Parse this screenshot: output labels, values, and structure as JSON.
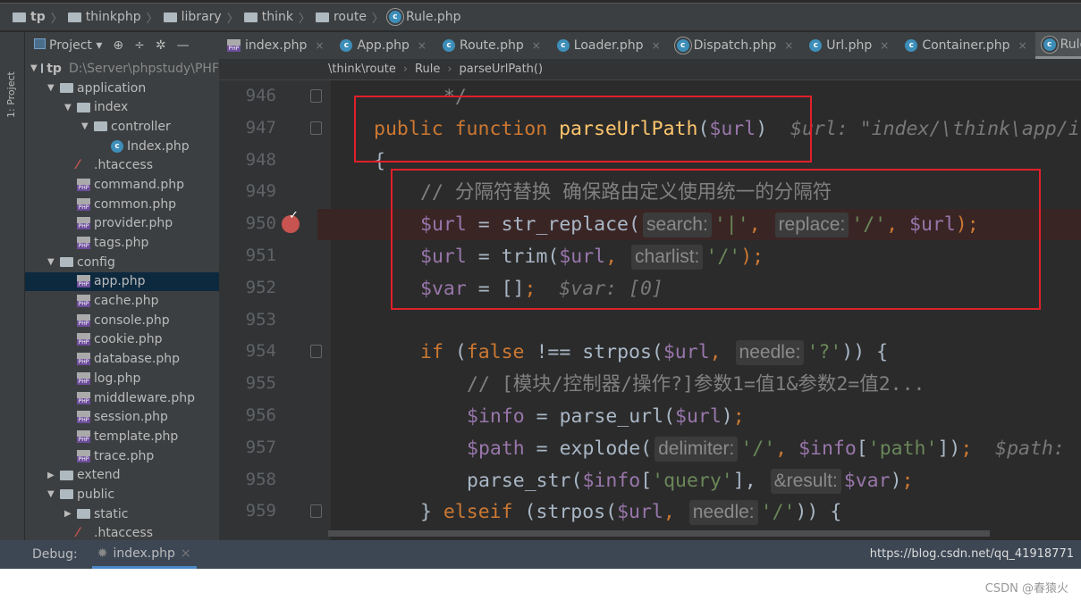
{
  "breadcrumb": [
    {
      "label": "tp",
      "icon": "folder"
    },
    {
      "label": "thinkphp",
      "icon": "folder"
    },
    {
      "label": "library",
      "icon": "folder"
    },
    {
      "label": "think",
      "icon": "folder"
    },
    {
      "label": "route",
      "icon": "folder"
    },
    {
      "label": "Rule.php",
      "icon": "php-class"
    }
  ],
  "left_stripe": {
    "label": "1: Project"
  },
  "project_panel": {
    "title": "Project",
    "tree": [
      {
        "label": "tp",
        "extra": "D:\\Server\\phpstudy\\PHF",
        "depth": 0,
        "type": "folder",
        "expanded": true
      },
      {
        "label": "application",
        "depth": 1,
        "type": "folder",
        "expanded": true
      },
      {
        "label": "index",
        "depth": 2,
        "type": "folder",
        "expanded": true
      },
      {
        "label": "controller",
        "depth": 3,
        "type": "folder",
        "expanded": true
      },
      {
        "label": "Index.php",
        "depth": 4,
        "type": "class"
      },
      {
        "label": ".htaccess",
        "depth": 2,
        "type": "htaccess"
      },
      {
        "label": "command.php",
        "depth": 2,
        "type": "php"
      },
      {
        "label": "common.php",
        "depth": 2,
        "type": "php"
      },
      {
        "label": "provider.php",
        "depth": 2,
        "type": "php"
      },
      {
        "label": "tags.php",
        "depth": 2,
        "type": "php"
      },
      {
        "label": "config",
        "depth": 1,
        "type": "folder",
        "expanded": true
      },
      {
        "label": "app.php",
        "depth": 2,
        "type": "php",
        "selected": true
      },
      {
        "label": "cache.php",
        "depth": 2,
        "type": "php"
      },
      {
        "label": "console.php",
        "depth": 2,
        "type": "php"
      },
      {
        "label": "cookie.php",
        "depth": 2,
        "type": "php"
      },
      {
        "label": "database.php",
        "depth": 2,
        "type": "php"
      },
      {
        "label": "log.php",
        "depth": 2,
        "type": "php"
      },
      {
        "label": "middleware.php",
        "depth": 2,
        "type": "php"
      },
      {
        "label": "session.php",
        "depth": 2,
        "type": "php"
      },
      {
        "label": "template.php",
        "depth": 2,
        "type": "php"
      },
      {
        "label": "trace.php",
        "depth": 2,
        "type": "php"
      },
      {
        "label": "extend",
        "depth": 1,
        "type": "folder",
        "expanded": false
      },
      {
        "label": "public",
        "depth": 1,
        "type": "folder",
        "expanded": true
      },
      {
        "label": "static",
        "depth": 2,
        "type": "folder",
        "expanded": false
      },
      {
        "label": ".htaccess",
        "depth": 2,
        "type": "htaccess"
      }
    ]
  },
  "tabs": [
    {
      "label": "index.php",
      "icon": "php"
    },
    {
      "label": "App.php",
      "icon": "class"
    },
    {
      "label": "Route.php",
      "icon": "class"
    },
    {
      "label": "Loader.php",
      "icon": "class"
    },
    {
      "label": "Dispatch.php",
      "icon": "abstract-class"
    },
    {
      "label": "Url.php",
      "icon": "class"
    },
    {
      "label": "Container.php",
      "icon": "class"
    },
    {
      "label": "Rule.php",
      "icon": "abstract-class",
      "active": true
    }
  ],
  "navbar": [
    "\\think\\route",
    "Rule",
    "parseUrlPath()"
  ],
  "editor": {
    "breakpoint_line": "950",
    "lines": [
      {
        "n": "946",
        "indent": 1,
        "tokens": [
          {
            "t": "  */",
            "c": "cm"
          }
        ],
        "fold": true
      },
      {
        "n": "947",
        "indent": 0,
        "tokens": [
          {
            "t": "public function ",
            "c": "kw"
          },
          {
            "t": "parseUrlPath",
            "c": "fn"
          },
          {
            "t": "(",
            "c": ""
          },
          {
            "t": "$url",
            "c": "var"
          },
          {
            "t": ")  ",
            "c": ""
          },
          {
            "t": "$url: \"index/\\think\\app/i",
            "c": "dbg"
          }
        ],
        "fold": true
      },
      {
        "n": "948",
        "indent": 0,
        "tokens": [
          {
            "t": "{",
            "c": ""
          }
        ]
      },
      {
        "n": "949",
        "indent": 1,
        "tokens": [
          {
            "t": "// 分隔符替换 确保路由定义使用统一的分隔符",
            "c": "cm"
          }
        ]
      },
      {
        "n": "950",
        "indent": 1,
        "tokens": [
          {
            "t": "$url",
            "c": "var"
          },
          {
            "t": " = str_replace(",
            "c": ""
          },
          {
            "t": "search:",
            "c": "hint"
          },
          {
            "t": "'|'",
            "c": "str"
          },
          {
            "t": ", ",
            "c": "kw"
          },
          {
            "t": "replace:",
            "c": "hint"
          },
          {
            "t": "'/'",
            "c": "str"
          },
          {
            "t": ", ",
            "c": "kw"
          },
          {
            "t": "$url",
            "c": "var"
          },
          {
            "t": ");",
            "c": "kw"
          }
        ]
      },
      {
        "n": "951",
        "indent": 1,
        "tokens": [
          {
            "t": "$url",
            "c": "var"
          },
          {
            "t": " = trim(",
            "c": ""
          },
          {
            "t": "$url",
            "c": "var"
          },
          {
            "t": ", ",
            "c": "kw"
          },
          {
            "t": "charlist:",
            "c": "hint"
          },
          {
            "t": "'/'",
            "c": "str"
          },
          {
            "t": ");",
            "c": "kw"
          }
        ]
      },
      {
        "n": "952",
        "indent": 1,
        "tokens": [
          {
            "t": "$var",
            "c": "var"
          },
          {
            "t": " = []",
            "c": ""
          },
          {
            "t": ";",
            "c": "kw"
          },
          {
            "t": "  $var: [0]",
            "c": "dbg"
          }
        ]
      },
      {
        "n": "953",
        "indent": 1,
        "tokens": []
      },
      {
        "n": "954",
        "indent": 1,
        "tokens": [
          {
            "t": "if",
            "c": "kw"
          },
          {
            "t": " (",
            "c": ""
          },
          {
            "t": "false",
            "c": "kw"
          },
          {
            "t": " !== strpos(",
            "c": ""
          },
          {
            "t": "$url",
            "c": "var"
          },
          {
            "t": ", ",
            "c": "kw"
          },
          {
            "t": "needle:",
            "c": "hint"
          },
          {
            "t": "'?'",
            "c": "str"
          },
          {
            "t": ")) {",
            "c": ""
          }
        ],
        "fold": true
      },
      {
        "n": "955",
        "indent": 2,
        "tokens": [
          {
            "t": "// [模块/控制器/操作?]参数1=值1&参数2=值2...",
            "c": "cm"
          }
        ]
      },
      {
        "n": "956",
        "indent": 2,
        "tokens": [
          {
            "t": "$info",
            "c": "var"
          },
          {
            "t": " = parse_url(",
            "c": ""
          },
          {
            "t": "$url",
            "c": "var"
          },
          {
            "t": ")",
            "c": ""
          },
          {
            "t": ";",
            "c": "kw"
          }
        ]
      },
      {
        "n": "957",
        "indent": 2,
        "tokens": [
          {
            "t": "$path",
            "c": "var"
          },
          {
            "t": " = explode(",
            "c": ""
          },
          {
            "t": "delimiter:",
            "c": "hint"
          },
          {
            "t": "'/'",
            "c": "str"
          },
          {
            "t": ", ",
            "c": "kw"
          },
          {
            "t": "$info",
            "c": "var"
          },
          {
            "t": "[",
            "c": ""
          },
          {
            "t": "'path'",
            "c": "str"
          },
          {
            "t": "])",
            "c": ""
          },
          {
            "t": ";",
            "c": "kw"
          },
          {
            "t": "  $path:",
            "c": "dbg"
          }
        ]
      },
      {
        "n": "958",
        "indent": 2,
        "tokens": [
          {
            "t": "parse_str(",
            "c": ""
          },
          {
            "t": "$info",
            "c": "var"
          },
          {
            "t": "[",
            "c": ""
          },
          {
            "t": "'query'",
            "c": "str"
          },
          {
            "t": "], ",
            "c": ""
          },
          {
            "t": "&result:",
            "c": "hint"
          },
          {
            "t": "$var",
            "c": "var"
          },
          {
            "t": ")",
            "c": ""
          },
          {
            "t": ";",
            "c": "kw"
          }
        ]
      },
      {
        "n": "959",
        "indent": 1,
        "tokens": [
          {
            "t": "} ",
            "c": ""
          },
          {
            "t": "elseif",
            "c": "kw"
          },
          {
            "t": " (strpos(",
            "c": ""
          },
          {
            "t": "$url",
            "c": "var"
          },
          {
            "t": ", ",
            "c": "kw"
          },
          {
            "t": "needle:",
            "c": "hint"
          },
          {
            "t": "'/'",
            "c": "str"
          },
          {
            "t": ")) {",
            "c": ""
          }
        ],
        "fold": true
      }
    ]
  },
  "debug": {
    "label": "Debug:",
    "tab": "index.php"
  },
  "watermark_url": "https://blog.csdn.net/qq_41918771",
  "watermark": "CSDN @春猿火",
  "colors": {
    "highlight": "#e0202a",
    "keyword": "#cc7832",
    "variable": "#9876aa",
    "string": "#6a8759",
    "function": "#ffc66d"
  }
}
